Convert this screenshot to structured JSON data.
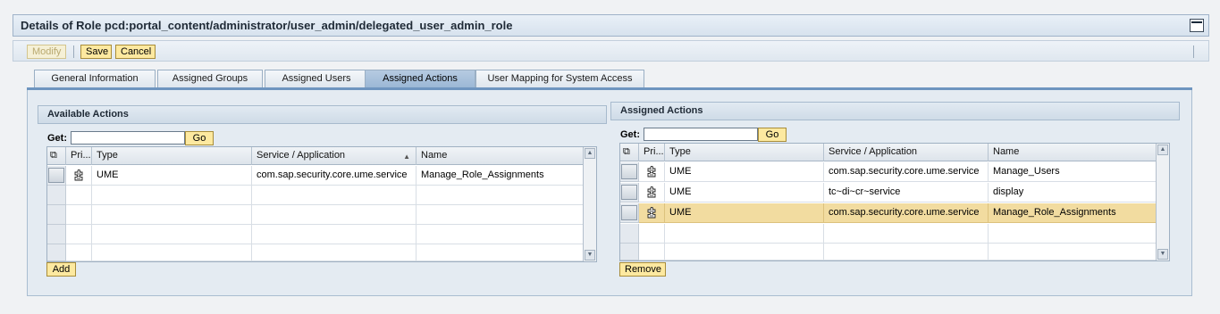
{
  "title": "Details of Role pcd:portal_content/administrator/user_admin/delegated_user_admin_role",
  "toolbar": {
    "modify_label": "Modify",
    "save_label": "Save",
    "cancel_label": "Cancel"
  },
  "tabs": [
    {
      "label": "General Information"
    },
    {
      "label": "Assigned Groups"
    },
    {
      "label": "Assigned Users"
    },
    {
      "label": "Assigned Actions",
      "active": true
    },
    {
      "label": "User Mapping for System Access"
    }
  ],
  "available": {
    "header": "Available Actions",
    "get_label": "Get:",
    "go_label": "Go",
    "search_value": "",
    "columns": {
      "pri": "Pri...",
      "type": "Type",
      "service": "Service / Application",
      "name": "Name"
    },
    "rows": [
      {
        "type": "UME",
        "service": "com.sap.security.core.ume.service",
        "name": "Manage_Role_Assignments"
      }
    ],
    "add_label": "Add"
  },
  "assigned": {
    "header": "Assigned Actions",
    "get_label": "Get:",
    "go_label": "Go",
    "search_value": "",
    "columns": {
      "pri": "Pri...",
      "type": "Type",
      "service": "Service / Application",
      "name": "Name"
    },
    "rows": [
      {
        "type": "UME",
        "service": "com.sap.security.core.ume.service",
        "name": "Manage_Users"
      },
      {
        "type": "UME",
        "service": "tc~di~cr~service",
        "name": "display"
      },
      {
        "type": "UME",
        "service": "com.sap.security.core.ume.service",
        "name": "Manage_Role_Assignments"
      }
    ],
    "remove_label": "Remove"
  },
  "colors": {
    "button_bg": "#fde9a0",
    "active_tab": "#9ab7d5",
    "selected_row": "#f2dca0"
  }
}
